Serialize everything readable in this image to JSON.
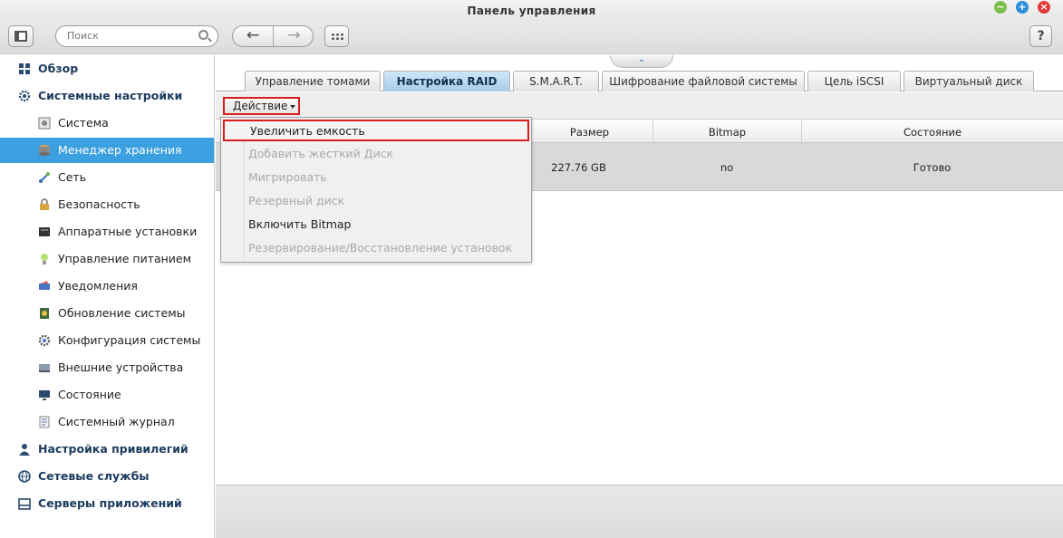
{
  "window": {
    "title": "Панель управления"
  },
  "toolbar": {
    "search_placeholder": "Поиск",
    "help_label": "?"
  },
  "sidebar": {
    "items": [
      {
        "label": "Обзор",
        "level": "top",
        "icon": "overview-icon"
      },
      {
        "label": "Системные настройки",
        "level": "top",
        "icon": "gear-icon"
      },
      {
        "label": "Система",
        "level": "sub",
        "icon": "system-icon"
      },
      {
        "label": "Менеджер хранения",
        "level": "sub",
        "icon": "storage-icon",
        "active": true
      },
      {
        "label": "Сеть",
        "level": "sub",
        "icon": "network-icon"
      },
      {
        "label": "Безопасность",
        "level": "sub",
        "icon": "lock-icon"
      },
      {
        "label": "Аппаратные установки",
        "level": "sub",
        "icon": "hardware-icon"
      },
      {
        "label": "Управление питанием",
        "level": "sub",
        "icon": "power-icon"
      },
      {
        "label": "Уведомления",
        "level": "sub",
        "icon": "notification-icon"
      },
      {
        "label": "Обновление системы",
        "level": "sub",
        "icon": "update-icon"
      },
      {
        "label": "Конфигурация системы",
        "level": "sub",
        "icon": "config-icon"
      },
      {
        "label": "Внешние устройства",
        "level": "sub",
        "icon": "external-device-icon"
      },
      {
        "label": "Состояние",
        "level": "sub",
        "icon": "monitor-icon"
      },
      {
        "label": "Системный журнал",
        "level": "sub",
        "icon": "log-icon"
      },
      {
        "label": "Настройка привилегий",
        "level": "top",
        "icon": "user-icon"
      },
      {
        "label": "Сетевые службы",
        "level": "top",
        "icon": "globe-icon"
      },
      {
        "label": "Серверы приложений",
        "level": "top",
        "icon": "server-icon"
      }
    ]
  },
  "tabs": [
    {
      "label": "Управление томами"
    },
    {
      "label": "Настройка RAID",
      "active": true
    },
    {
      "label": "S.M.A.R.T."
    },
    {
      "label": "Шифрование файловой системы"
    },
    {
      "label": "Цель iSCSI"
    },
    {
      "label": "Виртуальный диск"
    }
  ],
  "action": {
    "label": "Действие"
  },
  "table": {
    "columns": [
      "Размер",
      "Bitmap",
      "Состояние"
    ],
    "rows": [
      {
        "size": "227.76 GB",
        "bitmap": "no",
        "status": "Готово"
      }
    ]
  },
  "menu": {
    "items": [
      {
        "label": "Увеличить емкость",
        "enabled": true,
        "highlighted": true
      },
      {
        "label": "Добавить жесткий Диск",
        "enabled": false
      },
      {
        "label": "Мигрировать",
        "enabled": false
      },
      {
        "label": "Резервный диск",
        "enabled": false
      },
      {
        "label": "Включить Bitmap",
        "enabled": true
      },
      {
        "label": "Резервирование/Восстановление установок",
        "enabled": false
      }
    ]
  },
  "colors": {
    "accent": "#3aa0e0",
    "highlight_border": "#d81d1d",
    "active_tab": "#a6cbe8"
  }
}
